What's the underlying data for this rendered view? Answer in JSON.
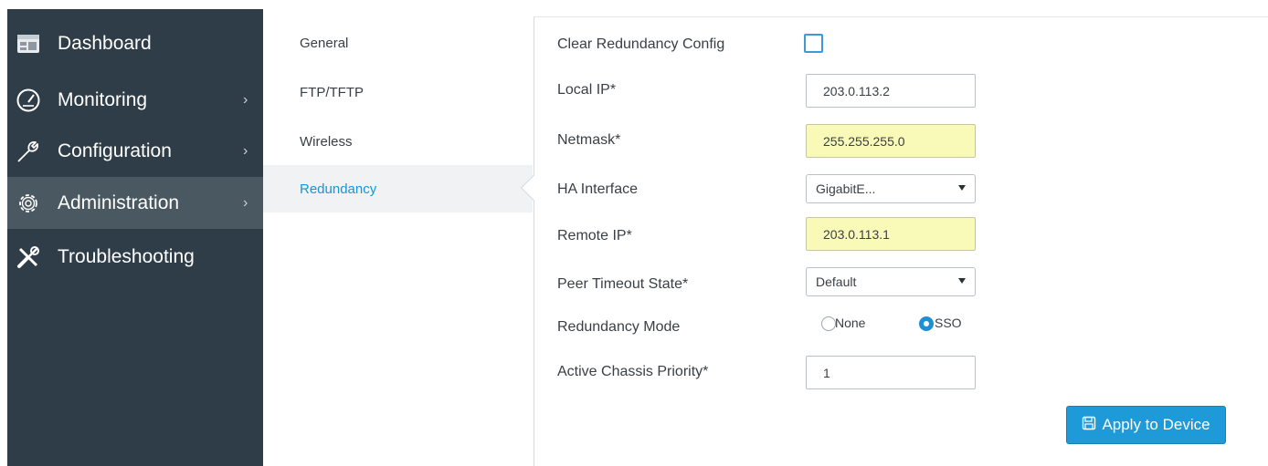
{
  "sidebar": {
    "items": [
      {
        "label": "Dashboard",
        "icon": "dashboard-icon",
        "chevron": ""
      },
      {
        "label": "Monitoring",
        "icon": "gauge-icon",
        "chevron": "›"
      },
      {
        "label": "Configuration",
        "icon": "wrench-icon",
        "chevron": "›"
      },
      {
        "label": "Administration",
        "icon": "gear-icon",
        "chevron": "›"
      },
      {
        "label": "Troubleshooting",
        "icon": "tools-icon",
        "chevron": ""
      }
    ],
    "active": "Administration"
  },
  "subnav": {
    "items": [
      "General",
      "FTP/TFTP",
      "Wireless",
      "Redundancy"
    ],
    "active": "Redundancy"
  },
  "form": {
    "clear_config_label": "Clear Redundancy Config",
    "clear_config_checked": false,
    "local_ip_label": "Local IP*",
    "local_ip_value": "203.0.113.2",
    "netmask_label": "Netmask*",
    "netmask_value": "255.255.255.0",
    "ha_interface_label": "HA Interface",
    "ha_interface_value": "GigabitE...",
    "remote_ip_label": "Remote IP*",
    "remote_ip_value": "203.0.113.1",
    "peer_timeout_label": "Peer Timeout State*",
    "peer_timeout_value": "Default",
    "redundancy_mode_label": "Redundancy Mode",
    "mode_options": [
      "None",
      "SSO"
    ],
    "mode_selected": "SSO",
    "priority_label": "Active Chassis Priority*",
    "priority_value": "1",
    "apply_label": "Apply to Device"
  },
  "colors": {
    "sidebar_bg": "#2f3d48",
    "sidebar_active": "#4a5862",
    "accent": "#1e9ad8",
    "warn_field": "#fafab8"
  }
}
